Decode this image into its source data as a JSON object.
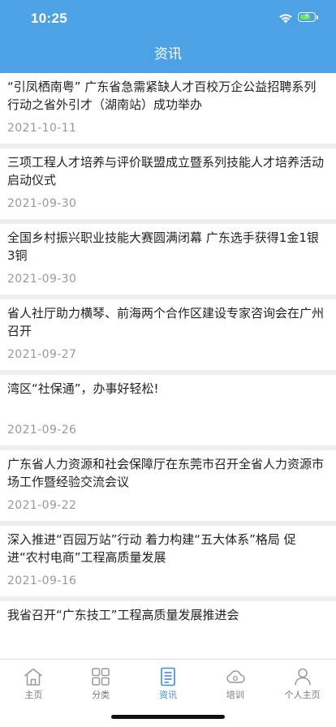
{
  "status_bar": {
    "time": "10:25"
  },
  "header": {
    "title": "资讯"
  },
  "news": [
    {
      "title": "“引凤栖南粤” 广东省急需紧缺人才百校万企公益招聘系列行动之省外引才（湖南站）成功举办",
      "date": "2021-10-11"
    },
    {
      "title": "三项工程人才培养与评价联盟成立暨系列技能人才培养活动启动仪式",
      "date": "2021-09-30"
    },
    {
      "title": "全国乡村振兴职业技能大赛圆满闭幕 广东选手获得1金1银3铜",
      "date": "2021-09-30"
    },
    {
      "title": "省人社厅助力横琴、前海两个合作区建设专家咨询会在广州召开",
      "date": "2021-09-27"
    },
    {
      "title": "湾区“社保通”，办事好轻松!",
      "date": "2021-09-26"
    },
    {
      "title": "广东省人力资源和社会保障厅在东莞市召开全省人力资源市场工作暨经验交流会议",
      "date": "2021-09-22"
    },
    {
      "title": "深入推进“百园万站”行动 着力构建“五大体系”格局 促进“农村电商”工程高质量发展",
      "date": "2021-09-16"
    },
    {
      "title": "我省召开“广东技工”工程高质量发展推进会",
      "date": ""
    }
  ],
  "tabs": [
    {
      "label": "主页",
      "icon": "home-icon"
    },
    {
      "label": "分类",
      "icon": "grid-icon"
    },
    {
      "label": "资讯",
      "icon": "document-icon",
      "active": true
    },
    {
      "label": "培训",
      "icon": "cloud-icon"
    },
    {
      "label": "个人主页",
      "icon": "person-icon"
    }
  ],
  "colors": {
    "header": "#4da2e6",
    "accent": "#3a8ee0",
    "battery": "#6fe35a"
  }
}
